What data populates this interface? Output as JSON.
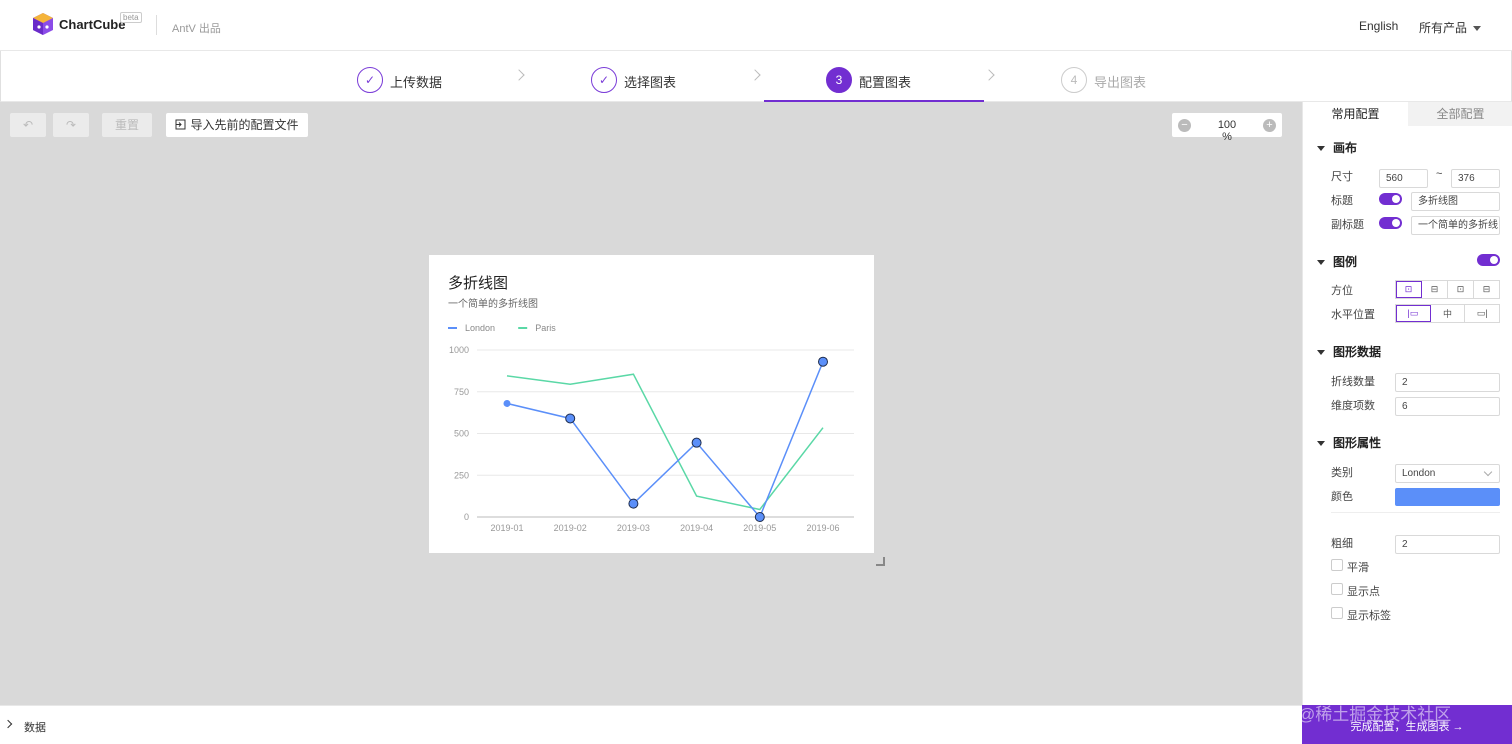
{
  "header": {
    "brand": "ChartCube",
    "beta": "beta",
    "org": "AntV 出品",
    "lang": "English",
    "products": "所有产品"
  },
  "steps": [
    {
      "label": "上传数据",
      "mark": "✓",
      "state": "done"
    },
    {
      "label": "选择图表",
      "mark": "✓",
      "state": "done"
    },
    {
      "label": "配置图表",
      "mark": "3",
      "state": "active"
    },
    {
      "label": "导出图表",
      "mark": "4",
      "state": "todo"
    }
  ],
  "toolbar": {
    "undo_icon": "↶",
    "redo_icon": "↷",
    "reset": "重置",
    "import": "导入先前的配置文件",
    "zoom_minus": "−",
    "zoom_plus": "+",
    "zoom": "100 %"
  },
  "colors": {
    "accent": "#722ed1",
    "london": "#5b8ff9",
    "paris": "#5ad8a6"
  },
  "chart_data": {
    "type": "line",
    "title": "多折线图",
    "subtitle": "一个简单的多折线图",
    "categories": [
      "2019-01",
      "2019-02",
      "2019-03",
      "2019-04",
      "2019-05",
      "2019-06"
    ],
    "series": [
      {
        "name": "London",
        "values": [
          680,
          590,
          80,
          445,
          0,
          930
        ],
        "color": "#5b8ff9"
      },
      {
        "name": "Paris",
        "values": [
          845,
          795,
          855,
          125,
          45,
          535
        ],
        "color": "#5ad8a6"
      }
    ],
    "yticks": [
      0,
      250,
      500,
      750,
      1000
    ],
    "ylim": [
      0,
      1000
    ],
    "grid": true,
    "legend_position": "top-left"
  },
  "panel": {
    "tab_common": "常用配置",
    "tab_all": "全部配置",
    "sec_canvas": "画布",
    "size_label": "尺寸",
    "width": "560",
    "size_sep": "~",
    "height": "376",
    "title_label": "标题",
    "title_value": "多折线图",
    "subtitle_label": "副标题",
    "subtitle_value": "一个简单的多折线",
    "sec_legend": "图例",
    "position_label": "方位",
    "position_options": [
      "⊡",
      "⊟",
      "⊡",
      "⊟"
    ],
    "hpos_label": "水平位置",
    "hpos_options": [
      "|▭",
      "中",
      "▭|"
    ],
    "sec_data": "图形数据",
    "line_count_label": "折线数量",
    "line_count": "2",
    "dim_count_label": "维度项数",
    "dim_count": "6",
    "sec_props": "图形属性",
    "category_label": "类别",
    "category_value": "London",
    "color_label": "颜色",
    "thickness_label": "粗细",
    "thickness": "2",
    "smooth_label": "平滑",
    "show_points_label": "显示点",
    "show_labels_label": "显示标签"
  },
  "bottom": {
    "data_label": "数据",
    "finish": "完成配置，生成图表 →",
    "watermark": "@稀土掘金技术社区"
  }
}
